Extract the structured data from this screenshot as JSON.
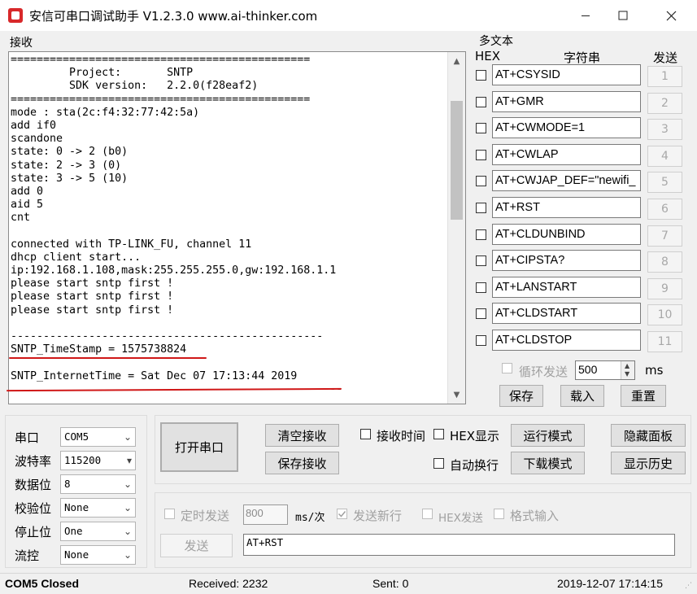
{
  "window": {
    "title": "安信可串口调试助手 V1.2.3.0    www.ai-thinker.com",
    "minimize_icon": "minimize-icon",
    "maximize_icon": "maximize-icon",
    "close_icon": "close-icon"
  },
  "receive": {
    "label": "接收",
    "lines": [
      "==============================================",
      "         Project:       SNTP",
      "         SDK version:   2.2.0(f28eaf2)",
      "==============================================",
      "mode : sta(2c:f4:32:77:42:5a)",
      "add if0",
      "scandone",
      "state: 0 -> 2 (b0)",
      "state: 2 -> 3 (0)",
      "state: 3 -> 5 (10)",
      "add 0",
      "aid 5",
      "cnt",
      "",
      "connected with TP-LINK_FU, channel 11",
      "dhcp client start...",
      "ip:192.168.1.108,mask:255.255.255.0,gw:192.168.1.1",
      "please start sntp first !",
      "please start sntp first !",
      "please start sntp first !",
      "",
      "------------------------------------------------",
      "SNTP_TimeStamp = 1575738824",
      "",
      "SNTP_InternetTime = Sat Dec 07 17:13:44 2019",
      "                                          ---------"
    ]
  },
  "multi_text": {
    "label": "多文本",
    "col_hex": "HEX",
    "col_string": "字符串",
    "col_send": "发送",
    "rows": [
      {
        "cmd": "AT+CSYSID",
        "num": "1"
      },
      {
        "cmd": "AT+GMR",
        "num": "2"
      },
      {
        "cmd": "AT+CWMODE=1",
        "num": "3"
      },
      {
        "cmd": "AT+CWLAP",
        "num": "4"
      },
      {
        "cmd": "AT+CWJAP_DEF=\"newifi_",
        "num": "5"
      },
      {
        "cmd": "AT+RST",
        "num": "6"
      },
      {
        "cmd": "AT+CLDUNBIND",
        "num": "7"
      },
      {
        "cmd": "AT+CIPSTA?",
        "num": "8"
      },
      {
        "cmd": "AT+LANSTART",
        "num": "9"
      },
      {
        "cmd": "AT+CLDSTART",
        "num": "10"
      },
      {
        "cmd": "AT+CLDSTOP",
        "num": "11"
      }
    ],
    "loop_send_label": "循环发送",
    "loop_interval": "500",
    "ms_label": "ms",
    "save_btn": "保存",
    "load_btn": "载入",
    "reset_btn": "重置"
  },
  "port": {
    "port_label": "串口",
    "port_value": "COM5",
    "baud_label": "波特率",
    "baud_value": "115200",
    "databits_label": "数据位",
    "databits_value": "8",
    "parity_label": "校验位",
    "parity_value": "None",
    "stopbits_label": "停止位",
    "stopbits_value": "One",
    "flow_label": "流控",
    "flow_value": "None"
  },
  "controls": {
    "open_port": "打开串口",
    "clear_recv": "清空接收",
    "save_recv": "保存接收",
    "recv_time": "接收时间",
    "hex_display": "HEX显示",
    "run_mode": "运行模式",
    "hide_panel": "隐藏面板",
    "auto_wrap": "自动换行",
    "download_mode": "下载模式",
    "show_history": "显示历史"
  },
  "send": {
    "timed_send": "定时发送",
    "interval": "800",
    "interval_unit": "ms/次",
    "send_newline": "发送新行",
    "hex_send": "HEX发送",
    "format_input": "格式输入",
    "send_btn": "发送",
    "send_text": "AT+RST"
  },
  "status": {
    "port_status": "COM5 Closed",
    "received": "Received: 2232",
    "sent": "Sent: 0",
    "datetime": "2019-12-07 17:14:15"
  }
}
